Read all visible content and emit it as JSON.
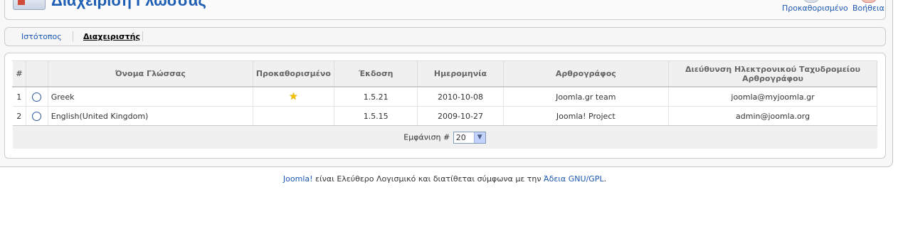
{
  "header": {
    "title": "Διαχείριση Γλώσσας",
    "toolbar": [
      {
        "label": "Προκαθορισμένο",
        "icon": "default-icon"
      },
      {
        "label": "Βοήθεια",
        "icon": "help-icon"
      }
    ]
  },
  "submenu": {
    "items": [
      {
        "label": "Ιστότοπος",
        "active": false
      },
      {
        "label": "Διαχειριστής",
        "active": true
      }
    ]
  },
  "table": {
    "columns": [
      "#",
      "",
      "Όνομα Γλώσσας",
      "Προκαθορισμένο",
      "Έκδοση",
      "Ημερομηνία",
      "Αρθρογράφος",
      "Διεύθυνση Ηλεκτρονικού Ταχυδρομείου Αρθρογράφου"
    ],
    "rows": [
      {
        "num": "1",
        "name": "Greek",
        "default": true,
        "version": "1.5.21",
        "date": "2010-10-08",
        "author": "Joomla.gr team",
        "email": "joomla@myjoomla.gr"
      },
      {
        "num": "2",
        "name": "English(United Kingdom)",
        "default": false,
        "version": "1.5.15",
        "date": "2009-10-27",
        "author": "Joomla! Project",
        "email": "admin@joomla.org"
      }
    ],
    "pagination": {
      "label": "Εμφάνιση #",
      "value": "20"
    }
  },
  "footer": {
    "link1": "Joomla!",
    "text": " είναι Ελεύθερο Λογισμικό και διατίθεται σύμφωνα με την ",
    "link2": "Άδεια GNU/GPL",
    "end": "."
  },
  "colors": {
    "link": "#1b57b1",
    "title": "#1f5fb3",
    "star": "#f2c200"
  }
}
